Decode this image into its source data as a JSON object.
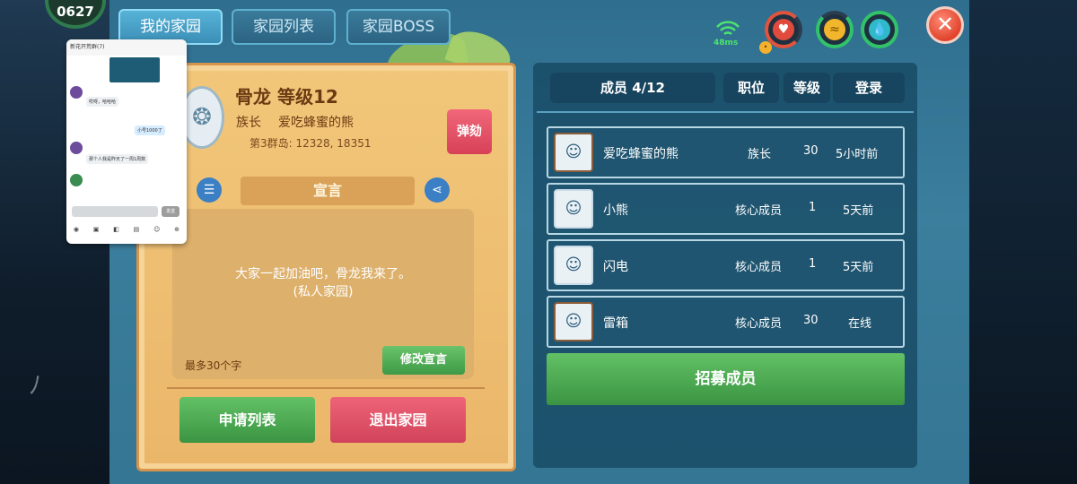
{
  "tabs": [
    {
      "label": "我的家园",
      "active": true
    },
    {
      "label": "家园列表",
      "active": false
    },
    {
      "label": "家园BOSS",
      "active": false
    }
  ],
  "corner_badge": "0627",
  "status": {
    "ping": "48ms",
    "icons": [
      "wifi-icon",
      "heart-icon",
      "energy-icon",
      "water-drop-icon",
      "close-icon"
    ],
    "colors": {
      "health": "#e2533d",
      "energy": "#31c26a",
      "water": "#2fb9c9",
      "close": "#e0442c"
    }
  },
  "clan": {
    "title": "骨龙 等级12",
    "leader_label": "族长",
    "leader_name": "爱吃蜂蜜的熊",
    "island": "第3群岛: 12328, 18351",
    "impeach_label": "弹劾",
    "declaration_title": "宣言",
    "declaration_text_line1": "大家一起加油吧，骨龙我来了。",
    "declaration_text_line2": "(私人家园)",
    "max_chars": "最多30个字",
    "edit_label": "修改宣言",
    "apply_list_label": "申请列表",
    "leave_label": "退出家园"
  },
  "members_header": {
    "members": "成员 4/12",
    "role": "职位",
    "level": "等级",
    "login": "登录"
  },
  "members": [
    {
      "name": "爱吃蜂蜜的熊",
      "role": "族长",
      "level": "30",
      "login": "5小时前"
    },
    {
      "name": "小熊",
      "role": "核心成员",
      "level": "1",
      "login": "5天前"
    },
    {
      "name": "闪电",
      "role": "核心成员",
      "level": "1",
      "login": "5天前"
    },
    {
      "name": "雷箱",
      "role": "核心成员",
      "level": "30",
      "login": "在线"
    }
  ],
  "recruit_label": "招募成员",
  "chat": {
    "header": "新花开荒群(7)",
    "msg1": "哎呀，哈哈哈",
    "msg2": "小号1000了",
    "msg3": "那个人我是昨天了一周1周数",
    "send_label": "发送"
  }
}
